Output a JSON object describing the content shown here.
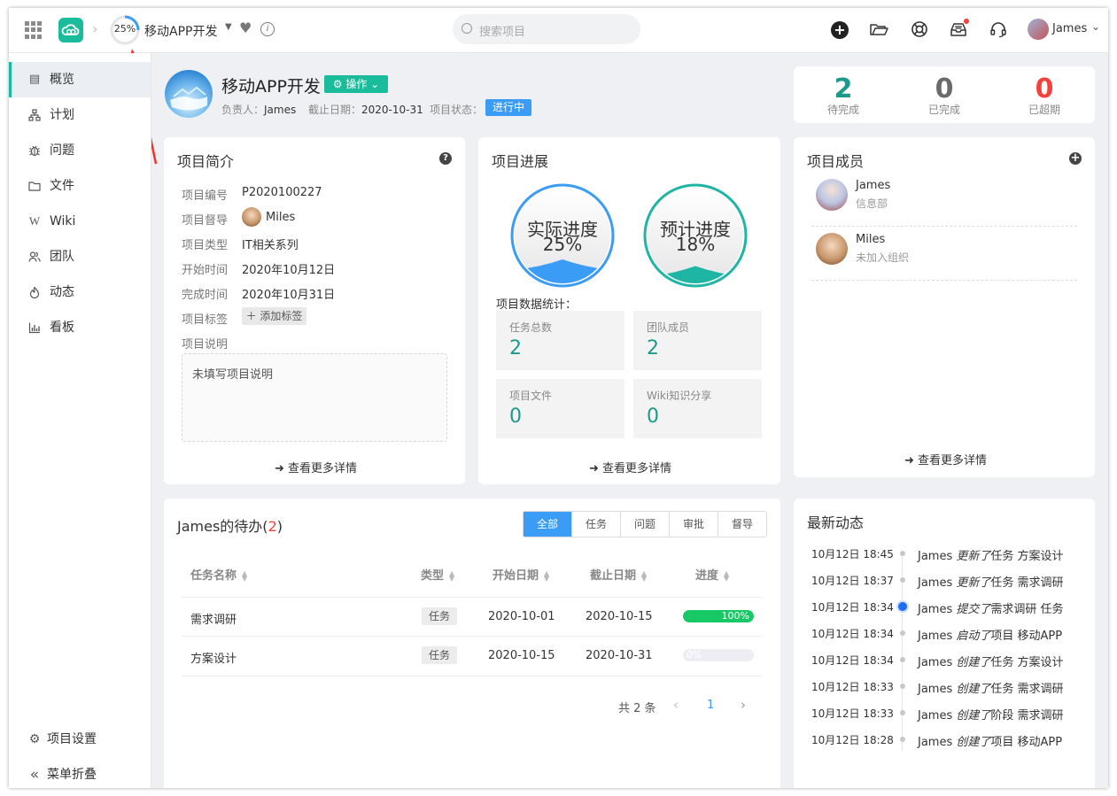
{
  "topbar": {
    "progress_text": "25%",
    "project_name": "移动APP开发",
    "search_placeholder": "搜索项目",
    "user_name": "James"
  },
  "sidebar": {
    "items": [
      {
        "label": "概览",
        "icon": "overview-icon"
      },
      {
        "label": "计划",
        "icon": "plan-icon"
      },
      {
        "label": "问题",
        "icon": "bug-icon"
      },
      {
        "label": "文件",
        "icon": "folder-icon"
      },
      {
        "label": "Wiki",
        "icon": "wiki-icon"
      },
      {
        "label": "团队",
        "icon": "team-icon"
      },
      {
        "label": "动态",
        "icon": "activity-icon"
      },
      {
        "label": "看板",
        "icon": "chart-icon"
      }
    ],
    "settings_label": "项目设置",
    "collapse_label": "菜单折叠"
  },
  "header": {
    "title": "移动APP开发",
    "op_button": "操作",
    "owner_label": "负责人：",
    "owner": "James",
    "deadline_label": "截止日期：",
    "deadline": "2020-10-31",
    "status_label": "项目状态：",
    "status": "进行中"
  },
  "stats": [
    {
      "value": "2",
      "label": "待完成",
      "color": "#1b9a8a"
    },
    {
      "value": "0",
      "label": "已完成",
      "color": "#6b6b6b"
    },
    {
      "value": "0",
      "label": "已超期",
      "color": "#f5413b"
    }
  ],
  "intro": {
    "title": "项目简介",
    "rows": [
      {
        "k": "项目编号",
        "v": "P2020100227"
      },
      {
        "k": "项目督导",
        "v": "Miles"
      },
      {
        "k": "项目类型",
        "v": "IT相关系列"
      },
      {
        "k": "开始时间",
        "v": "2020年10月12日"
      },
      {
        "k": "完成时间",
        "v": "2020年10月31日"
      },
      {
        "k": "项目标签",
        "v": "添加标签"
      },
      {
        "k": "项目说明",
        "v": ""
      }
    ],
    "description": "未填写项目说明",
    "more": "查看更多详情"
  },
  "progress": {
    "title": "项目进展",
    "actual_label": "实际进度",
    "actual_value": "25%",
    "actual_fraction": 0.25,
    "expected_label": "预计进度",
    "expected_value": "18%",
    "expected_fraction": 0.18,
    "stats_title": "项目数据统计：",
    "boxes": [
      {
        "label": "任务总数",
        "value": "2"
      },
      {
        "label": "团队成员",
        "value": "2"
      },
      {
        "label": "项目文件",
        "value": "0"
      },
      {
        "label": "Wiki知识分享",
        "value": "0"
      }
    ],
    "more": "查看更多详情"
  },
  "members": {
    "title": "项目成员",
    "list": [
      {
        "name": "James",
        "dept": "信息部"
      },
      {
        "name": "Miles",
        "dept": "未加入组织"
      }
    ],
    "more": "查看更多详情"
  },
  "todo": {
    "title_prefix": "James的待办(",
    "count": "2",
    "title_suffix": ")",
    "tabs": [
      "全部",
      "任务",
      "问题",
      "审批",
      "督导"
    ],
    "headers": [
      "任务名称",
      "类型",
      "开始日期",
      "截止日期",
      "进度"
    ],
    "rows": [
      {
        "name": "需求调研",
        "type": "任务",
        "start": "2020-10-01",
        "end": "2020-10-15",
        "progress": "100%",
        "fraction": 1.0
      },
      {
        "name": "方案设计",
        "type": "任务",
        "start": "2020-10-15",
        "end": "2020-10-31",
        "progress": "0%",
        "fraction": 0
      }
    ],
    "total": "共 2 条",
    "page": "1"
  },
  "activity": {
    "title": "最新动态",
    "items": [
      {
        "time": "10月12日 18:45",
        "user": "James",
        "verb": "更新了",
        "obj": "任务 方案设计"
      },
      {
        "time": "10月12日 18:37",
        "user": "James",
        "verb": "更新了",
        "obj": "任务 需求调研"
      },
      {
        "time": "10月12日 18:34",
        "user": "James",
        "verb": "提交了",
        "obj": "需求调研 任务"
      },
      {
        "time": "10月12日 18:34",
        "user": "James",
        "verb": "启动了",
        "obj": "项目 移动APP"
      },
      {
        "time": "10月12日 18:34",
        "user": "James",
        "verb": "创建了",
        "obj": "任务 方案设计"
      },
      {
        "time": "10月12日 18:33",
        "user": "James",
        "verb": "创建了",
        "obj": "任务 需求调研"
      },
      {
        "time": "10月12日 18:33",
        "user": "James",
        "verb": "创建了",
        "obj": "阶段 需求调研"
      },
      {
        "time": "10月12日 18:28",
        "user": "James",
        "verb": "创建了",
        "obj": "项目 移动APP"
      }
    ]
  },
  "colors": {
    "accent": "#1abc9c",
    "blue": "#3a9cf4",
    "red": "#f5413b",
    "green": "#17c964"
  }
}
